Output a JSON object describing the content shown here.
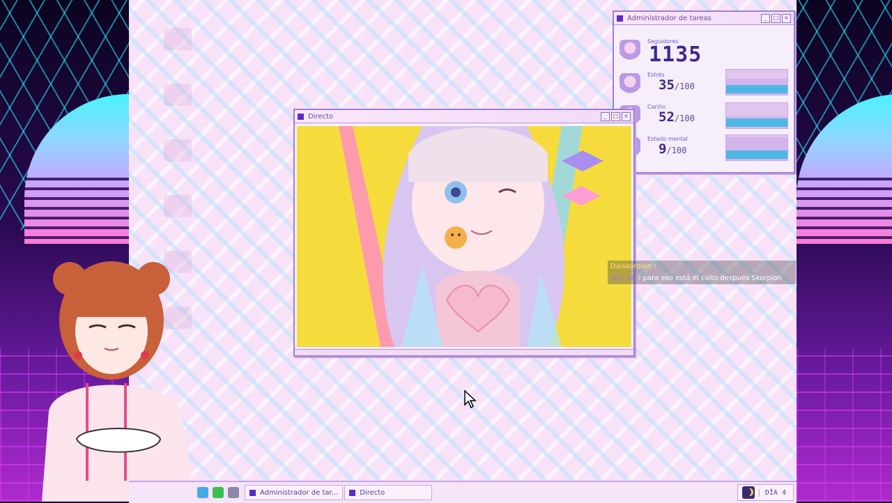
{
  "task_manager": {
    "title": "Administrador de tareas",
    "stats": [
      {
        "label": "Seguidores",
        "value": "1135"
      },
      {
        "label": "Estrés",
        "value": "35",
        "max": "/100",
        "level": 0.35
      },
      {
        "label": "Cariño",
        "value": "52",
        "max": "/100",
        "level": 0.52
      },
      {
        "label": "Estado mental",
        "value": "9",
        "max": "/100",
        "level": 0.09
      }
    ]
  },
  "live_window": {
    "title": "Directo"
  },
  "chat": [
    {
      "user": "Daiskorpion",
      "text": ":"
    },
    {
      "user": "Jero_60",
      "text": ": para eso está el coito después Skorpion"
    }
  ],
  "taskbar": {
    "task_buttons": [
      "Administrador de tar...",
      "Directo"
    ],
    "day_label": "DÍA 4"
  },
  "colors": {
    "desktop_bg": "#f8e2f8",
    "accent": "#5a2cc8",
    "window_border": "#9f7fd0",
    "stat_line": "#4db8e6"
  }
}
